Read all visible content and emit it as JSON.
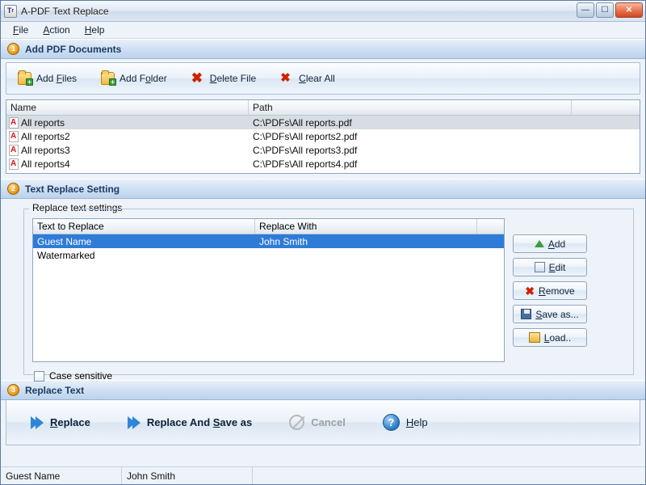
{
  "window": {
    "title": "A-PDF Text Replace",
    "app_icon": "document-text-icon",
    "buttons": {
      "minimize": "minimize-icon",
      "maximize": "maximize-icon",
      "close": "close-icon"
    }
  },
  "menubar": [
    {
      "label": "File",
      "accel": "F"
    },
    {
      "label": "Action",
      "accel": "A"
    },
    {
      "label": "Help",
      "accel": "H"
    }
  ],
  "sections": {
    "add_documents": {
      "step": "1",
      "title": "Add PDF Documents"
    },
    "text_replace_setting": {
      "step": "2",
      "title": "Text Replace Setting"
    },
    "replace_text": {
      "step": "3",
      "title": "Replace Text"
    }
  },
  "toolbar": [
    {
      "label": "Add Files",
      "accel_prefix": "Add ",
      "accel": "F",
      "accel_suffix": "iles",
      "icon": "add-files-icon"
    },
    {
      "label": "Add Folder",
      "accel_prefix": "Add F",
      "accel": "o",
      "accel_suffix": "lder",
      "icon": "add-folder-icon"
    },
    {
      "label": "Delete File",
      "accel_prefix": "",
      "accel": "D",
      "accel_suffix": "elete File",
      "icon": "delete-file-icon"
    },
    {
      "label": "Clear All",
      "accel_prefix": "",
      "accel": "C",
      "accel_suffix": "lear All",
      "icon": "clear-all-icon"
    }
  ],
  "file_list": {
    "columns": [
      "Name",
      "Path",
      ""
    ],
    "rows": [
      {
        "name": "All reports",
        "path": "C:\\PDFs\\All reports.pdf",
        "selected": true
      },
      {
        "name": "All reports2",
        "path": "C:\\PDFs\\All reports2.pdf",
        "selected": false
      },
      {
        "name": "All reports3",
        "path": "C:\\PDFs\\All reports3.pdf",
        "selected": false
      },
      {
        "name": "All reports4",
        "path": "C:\\PDFs\\All reports4.pdf",
        "selected": false
      }
    ]
  },
  "replace_settings": {
    "group_label": "Replace text settings",
    "columns": [
      "Text to Replace",
      "Replace With",
      ""
    ],
    "rows": [
      {
        "find": "Guest Name",
        "replace": "John Smith",
        "selected": true
      },
      {
        "find": "Watermarked",
        "replace": "",
        "selected": false
      }
    ],
    "case_sensitive": {
      "label": "Case sensitive",
      "checked": false
    },
    "buttons": [
      {
        "label": "Add",
        "accel_prefix": "",
        "accel": "A",
        "accel_suffix": "dd",
        "icon": "arrow-up-icon"
      },
      {
        "label": "Edit",
        "accel_prefix": "",
        "accel": "E",
        "accel_suffix": "dit",
        "icon": "edit-icon"
      },
      {
        "label": "Remove",
        "accel_prefix": "",
        "accel": "R",
        "accel_suffix": "emove",
        "icon": "remove-x-icon"
      },
      {
        "label": "Save as...",
        "accel_prefix": "",
        "accel": "S",
        "accel_suffix": "ave as...",
        "icon": "save-disk-icon"
      },
      {
        "label": "Load..",
        "accel_prefix": "",
        "accel": "L",
        "accel_suffix": "oad..",
        "icon": "load-folder-icon"
      }
    ]
  },
  "action_bar": [
    {
      "label": "Replace",
      "accel_prefix": "",
      "accel": "R",
      "accel_suffix": "eplace",
      "icon": "double-arrow-icon",
      "enabled": true
    },
    {
      "label": "Replace And Save as",
      "accel_prefix": "Replace And ",
      "accel": "S",
      "accel_suffix": "ave as",
      "icon": "double-arrow-icon",
      "enabled": true
    },
    {
      "label": "Cancel",
      "accel_prefix": "",
      "accel": "C",
      "accel_suffix": "ancel",
      "icon": "cancel-ban-icon",
      "enabled": false
    },
    {
      "label": "Help",
      "accel_prefix": "",
      "accel": "H",
      "accel_suffix": "elp",
      "icon": "help-circle-icon",
      "enabled": true
    }
  ],
  "statusbar": {
    "cell1": "Guest Name",
    "cell2": "John Smith",
    "cell3": ""
  },
  "colors": {
    "selection_blue": "#2f7bd8",
    "accent_orange": "#e8940f",
    "arrow_blue": "#2f86d8",
    "delete_red": "#cc2200"
  }
}
